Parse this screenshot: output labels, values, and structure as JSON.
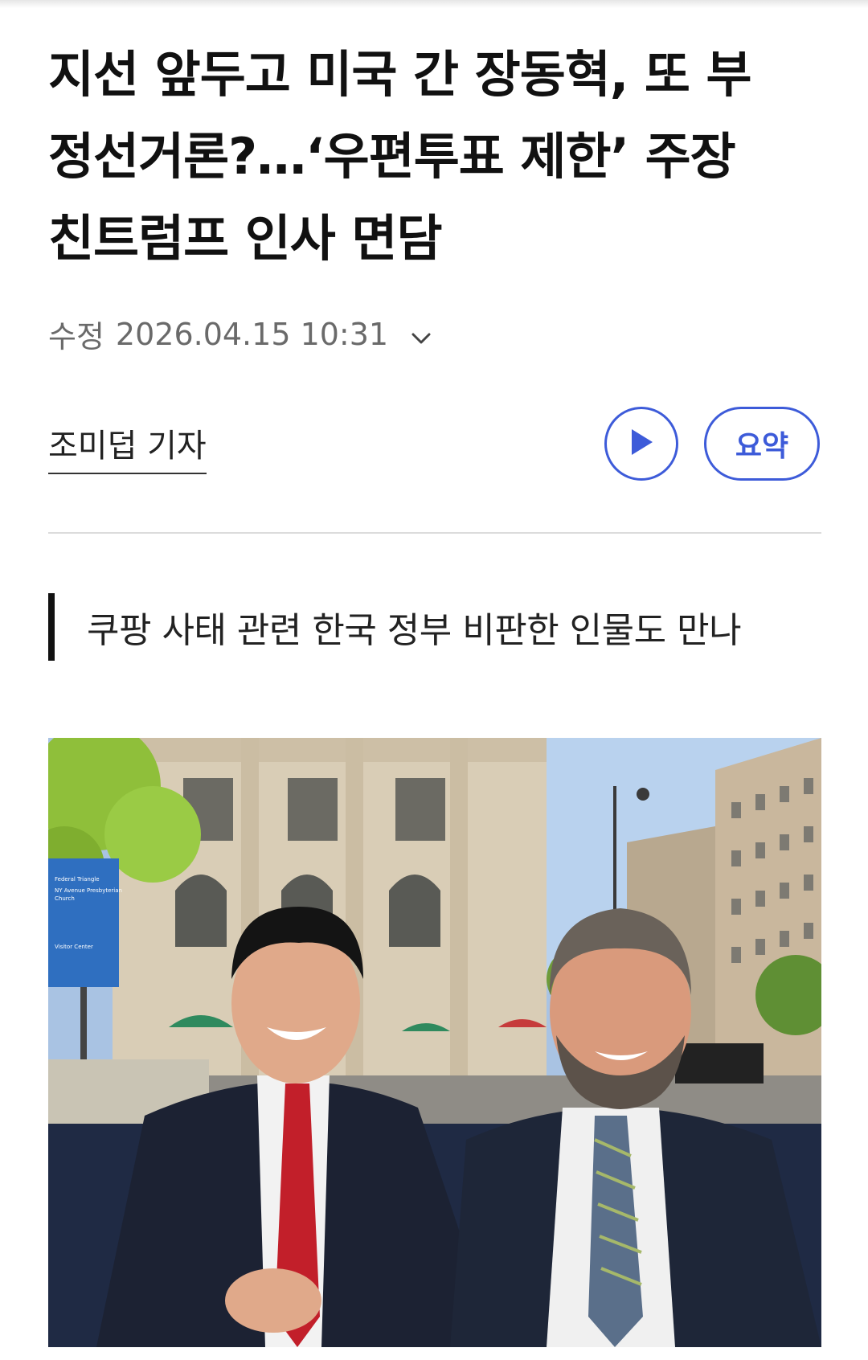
{
  "article": {
    "headline_lines": [
      "지선 앞두고 미국 간 장동혁, 또 부",
      "정선거론?…‘우편투표 제한’ 주장",
      "친트럼프 인사 면담"
    ],
    "meta": {
      "modified_label": "수정",
      "datetime": "2026.04.15 10:31",
      "expand_icon": "chevron-down-icon"
    },
    "byline": "조미덥 기자",
    "buttons": {
      "play_icon": "play-icon",
      "summary_label": "요약"
    },
    "subheading": "쿠팡 사태 관련 한국 정부 비판한 인물도 만나",
    "photo": {
      "sign_lines": [
        "Federal Triangle",
        "NY Avenue Presbyterian",
        "Church",
        "Visitor Center"
      ]
    }
  },
  "colors": {
    "accent": "#3d5bd9",
    "text": "#111111",
    "muted": "#6a6a6a",
    "divider": "#dcdcdc"
  }
}
